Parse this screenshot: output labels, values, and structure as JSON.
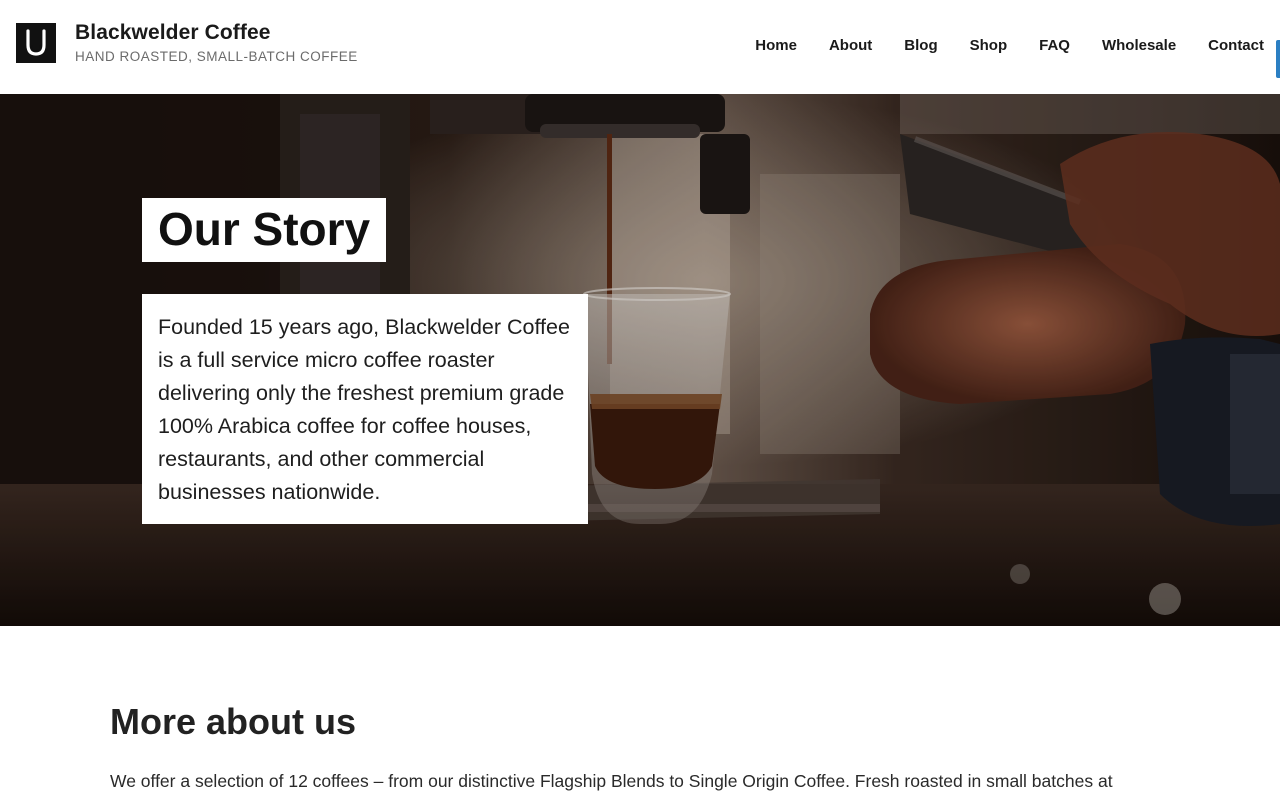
{
  "header": {
    "site_title": "Blackwelder Coffee",
    "tagline": "HAND ROASTED, SMALL-BATCH COFFEE",
    "logo_icon": "horseshoe-icon",
    "nav": [
      {
        "label": "Home"
      },
      {
        "label": "About"
      },
      {
        "label": "Blog"
      },
      {
        "label": "Shop"
      },
      {
        "label": "FAQ"
      },
      {
        "label": "Wholesale"
      },
      {
        "label": "Contact"
      }
    ]
  },
  "hero": {
    "title": "Our Story",
    "text": "Founded 15 years ago, Blackwelder Coffee is a full service micro coffee roaster delivering only the freshest premium grade 100% Arabica coffee for coffee houses, restaurants, and other commercial businesses nationwide."
  },
  "content": {
    "heading": "More about us",
    "body": "We offer a selection of 12 coffees – from our distinctive Flagship Blends to Single Origin Coffee. Fresh roasted in small batches at"
  },
  "colors": {
    "accent": "#2b7fc3",
    "header_bg": "#ffffff",
    "hero_dark": "#1c120d"
  }
}
